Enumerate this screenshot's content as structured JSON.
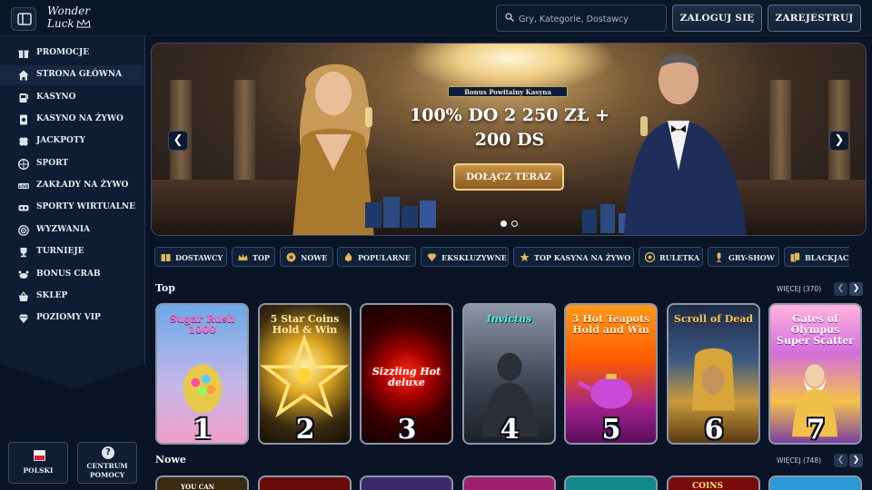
{
  "header": {
    "logo_line1": "Wonder",
    "logo_line2": "Luck",
    "search_placeholder": "Gry, Kategorie, Dostawcy",
    "login_label": "ZALOGUJ SIĘ",
    "register_label": "ZAREJESTRUJ"
  },
  "sidebar": {
    "items": [
      {
        "label": "PROMOCJE",
        "icon": "gift-icon"
      },
      {
        "label": "STRONA GŁÓWNA",
        "icon": "home-icon"
      },
      {
        "label": "KASYNO",
        "icon": "slot-icon"
      },
      {
        "label": "KASYNO NA ŻYWO",
        "icon": "live-card-icon"
      },
      {
        "label": "JACKPOTY",
        "icon": "clover-icon"
      },
      {
        "label": "SPORT",
        "icon": "ball-icon"
      },
      {
        "label": "ZAKŁADY NA ŻYWO",
        "icon": "live-badge-icon"
      },
      {
        "label": "SPORTY WIRTUALNE",
        "icon": "vr-icon"
      },
      {
        "label": "WYZWANIA",
        "icon": "target-icon"
      },
      {
        "label": "TURNIEJE",
        "icon": "trophy-icon"
      },
      {
        "label": "BONUS CRAB",
        "icon": "crab-icon"
      },
      {
        "label": "SKLEP",
        "icon": "basket-icon"
      },
      {
        "label": "POZIOMY VIP",
        "icon": "diamond-icon"
      }
    ],
    "footer": {
      "language_label": "POLSKI",
      "help_line1": "CENTRUM",
      "help_line2": "POMOCY"
    }
  },
  "banner": {
    "tag": "Bonus Powitalny Kasyna",
    "headline_line1": "100% DO 2 250 ZŁ +",
    "headline_line2": "200 DS",
    "cta_label": "DOŁĄCZ TERAZ",
    "active_slide": 1,
    "slide_count": 2
  },
  "categories": [
    {
      "label": "DOSTAWCY",
      "icon": "book-icon"
    },
    {
      "label": "TOP",
      "icon": "crown-icon"
    },
    {
      "label": "NOWE",
      "icon": "new-icon"
    },
    {
      "label": "POPULARNE",
      "icon": "flame-icon"
    },
    {
      "label": "EKSKLUZYWNE",
      "icon": "gem-icon"
    },
    {
      "label": "TOP KASYNA NA ŻYWO",
      "icon": "star-icon"
    },
    {
      "label": "RULETKA",
      "icon": "roulette-icon"
    },
    {
      "label": "GRY-SHOW",
      "icon": "mic-icon"
    },
    {
      "label": "BLACKJACK",
      "icon": "cards-icon"
    }
  ],
  "sections": {
    "top": {
      "title": "Top",
      "more_label": "WIĘCEJ (370)"
    },
    "new": {
      "title": "Nowe",
      "more_label": "WIĘCEJ (748)"
    }
  },
  "top_games": [
    {
      "name": "Sugar Rush 1000",
      "rank": "1",
      "name_color": "#ff6ab8"
    },
    {
      "name": "5 Star Coins Hold & Win",
      "rank": "2",
      "name_color": "#ffe9a0"
    },
    {
      "name": "Sizzling Hot deluxe",
      "rank": "3",
      "name_color": "#ffffff"
    },
    {
      "name": "Invictus",
      "rank": "4",
      "name_color": "#4fe8e0"
    },
    {
      "name": "3 Hot Teapots Hold and Win",
      "rank": "5",
      "name_color": "#fff0c0"
    },
    {
      "name": "Scroll of Dead",
      "rank": "6",
      "name_color": "#f3c25a"
    },
    {
      "name": "Gates of Olympus Super Scatter",
      "rank": "7",
      "name_color": "#ffffff"
    }
  ],
  "new_games_preview": [
    {
      "name": "YOU CAN"
    },
    {
      "name": ""
    },
    {
      "name": ""
    },
    {
      "name": ""
    },
    {
      "name": ""
    },
    {
      "name": "COINS"
    },
    {
      "name": ""
    }
  ]
}
